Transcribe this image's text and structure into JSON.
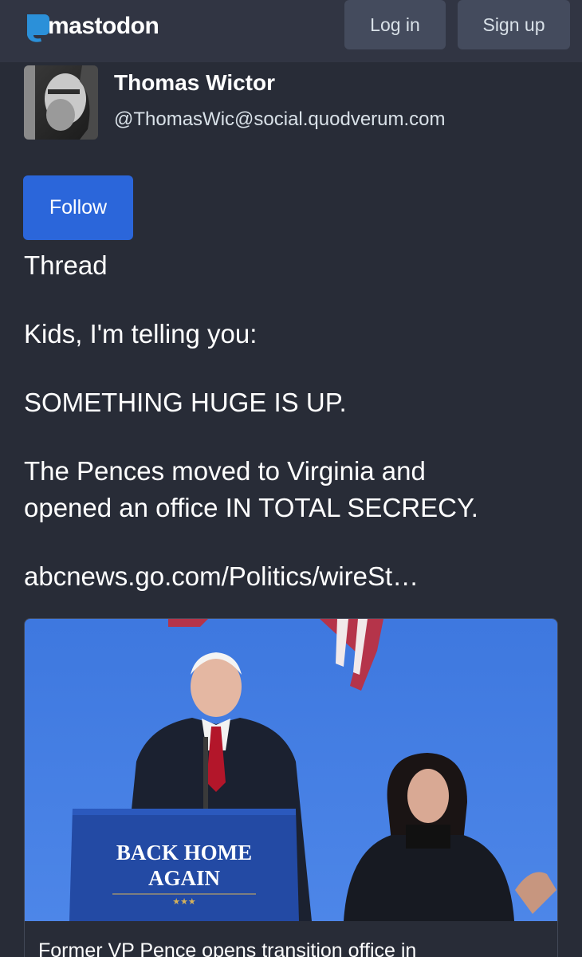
{
  "header": {
    "logo_text": "mastodon",
    "login_label": "Log in",
    "signup_label": "Sign up"
  },
  "profile": {
    "display_name": "Thomas Wictor",
    "handle": "@ThomasWic@social.quodverum.com",
    "follow_label": "Follow"
  },
  "post": {
    "lines": [
      "Thread",
      "Kids, I'm telling you:",
      "SOMETHING HUGE IS UP.",
      "The Pences moved to Virginia and",
      "opened an office IN TOTAL SECRECY."
    ],
    "link_text": "abcnews.go.com/Politics/wireSt…"
  },
  "card": {
    "podium_line1": "BACK HOME",
    "podium_line2": "AGAIN",
    "podium_stars": "★★★",
    "title": "Former VP Pence opens transition office in"
  },
  "colors": {
    "background": "#282c37",
    "topbar": "#313543",
    "button": "#444b5d",
    "follow": "#2b66da",
    "brand": "#2b90d9"
  }
}
